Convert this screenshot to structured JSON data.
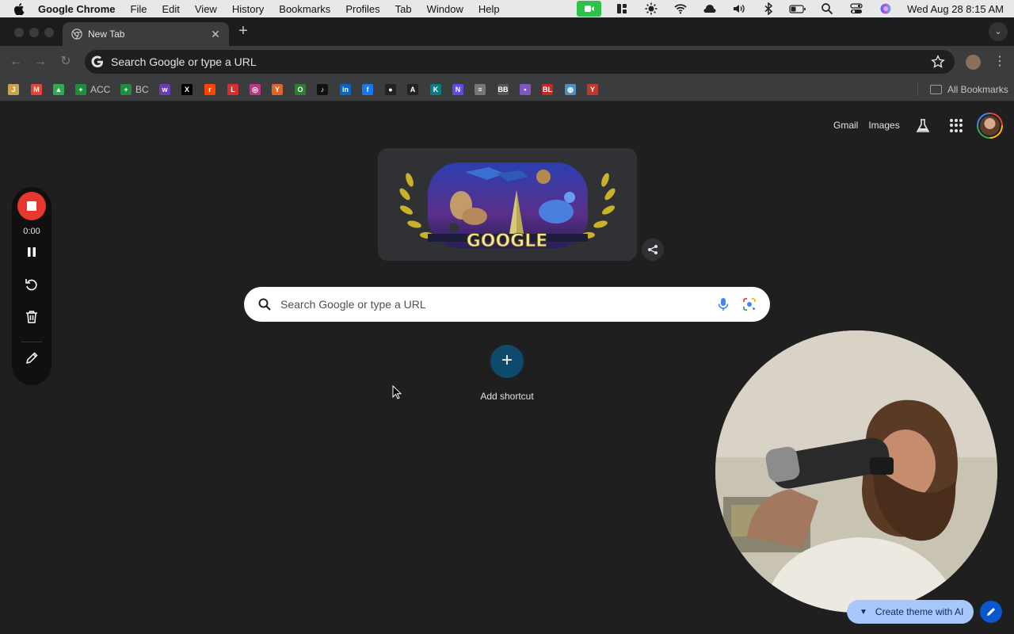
{
  "menubar": {
    "app_name": "Google Chrome",
    "items": [
      "File",
      "Edit",
      "View",
      "History",
      "Bookmarks",
      "Profiles",
      "Tab",
      "Window",
      "Help"
    ],
    "clock": "Wed Aug 28  8:15 AM"
  },
  "tabs": [
    {
      "title": "New Tab"
    }
  ],
  "omnibox": {
    "text": "Search Google or type a URL"
  },
  "bookmarks": [
    {
      "label": "",
      "icon": "J",
      "color": "#c9a44a"
    },
    {
      "label": "",
      "icon": "M",
      "color": "#ea4335"
    },
    {
      "label": "",
      "icon": "▲",
      "color": "#34a853"
    },
    {
      "label": "ACC",
      "icon": "+",
      "color": "#1e8e3e"
    },
    {
      "label": "BC",
      "icon": "+",
      "color": "#1e8e3e"
    },
    {
      "label": "",
      "icon": "w",
      "color": "#6a3fb5"
    },
    {
      "label": "",
      "icon": "X",
      "color": "#000000"
    },
    {
      "label": "",
      "icon": "r",
      "color": "#ff4500"
    },
    {
      "label": "",
      "icon": "L",
      "color": "#d32f2f"
    },
    {
      "label": "",
      "icon": "◎",
      "color": "#c13584"
    },
    {
      "label": "",
      "icon": "Y",
      "color": "#e0652a"
    },
    {
      "label": "",
      "icon": "O",
      "color": "#2e7d32"
    },
    {
      "label": "",
      "icon": "♪",
      "color": "#111111"
    },
    {
      "label": "",
      "icon": "in",
      "color": "#0a66c2"
    },
    {
      "label": "",
      "icon": "f",
      "color": "#1877f2"
    },
    {
      "label": "",
      "icon": "●",
      "color": "#222222"
    },
    {
      "label": "",
      "icon": "A",
      "color": "#222222"
    },
    {
      "label": "",
      "icon": "K",
      "color": "#0e7c86"
    },
    {
      "label": "",
      "icon": "N",
      "color": "#5c4ee5"
    },
    {
      "label": "",
      "icon": "≡",
      "color": "#777777"
    },
    {
      "label": "",
      "icon": "BB",
      "color": "#555555"
    },
    {
      "label": "",
      "icon": "▪",
      "color": "#7e57c2"
    },
    {
      "label": "",
      "icon": "BL",
      "color": "#c62828"
    },
    {
      "label": "",
      "icon": "◍",
      "color": "#4a90c2"
    },
    {
      "label": "",
      "icon": "Y",
      "color": "#c0392b"
    }
  ],
  "all_bookmarks": "All Bookmarks",
  "ntp": {
    "gmail": "Gmail",
    "images": "Images",
    "doodle_text": "GOOGLE",
    "search_placeholder": "Search Google or type a URL",
    "add_shortcut": "Add shortcut",
    "create_theme": "Create theme with AI"
  },
  "recorder": {
    "time": "0:00"
  }
}
